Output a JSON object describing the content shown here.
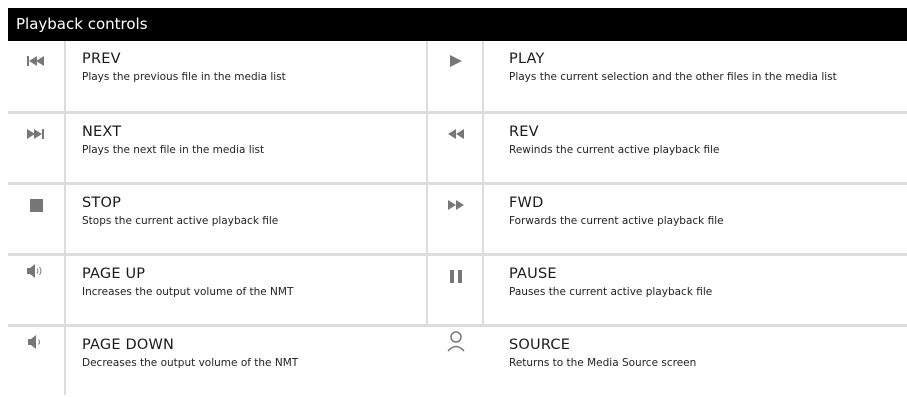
{
  "header": {
    "title": "Playback controls"
  },
  "rows": [
    {
      "left": {
        "icon": "previous-track-icon",
        "title": "PREV",
        "desc": "Plays the previous file in the media list"
      },
      "right": {
        "icon": "play-icon",
        "title": "PLAY",
        "desc": "Plays the current selection and the other files in the media list"
      }
    },
    {
      "left": {
        "icon": "next-track-icon",
        "title": "NEXT",
        "desc": "Plays the next file in the media list"
      },
      "right": {
        "icon": "rewind-icon",
        "title": "REV",
        "desc": "Rewinds the current active playback file"
      }
    },
    {
      "left": {
        "icon": "stop-icon",
        "title": "STOP",
        "desc": "Stops the current active playback file"
      },
      "right": {
        "icon": "fast-forward-icon",
        "title": "FWD",
        "desc": "Forwards the current active playback file"
      }
    },
    {
      "left": {
        "icon": "volume-up-icon",
        "title": "PAGE UP",
        "desc": "Increases the output volume of the NMT"
      },
      "right": {
        "icon": "pause-icon",
        "title": "PAUSE",
        "desc": "Pauses the current active playback file"
      }
    },
    {
      "left": {
        "icon": "volume-down-icon",
        "title": "PAGE DOWN",
        "desc": "Decreases the output volume of the NMT"
      },
      "right": {
        "icon": "source-icon",
        "title": "SOURCE",
        "desc": "Returns to the Media Source screen"
      }
    }
  ],
  "colors": {
    "header_bg": "#000000",
    "header_text": "#ffffff",
    "icon": "#777777",
    "divider": "#dcdcdc"
  }
}
